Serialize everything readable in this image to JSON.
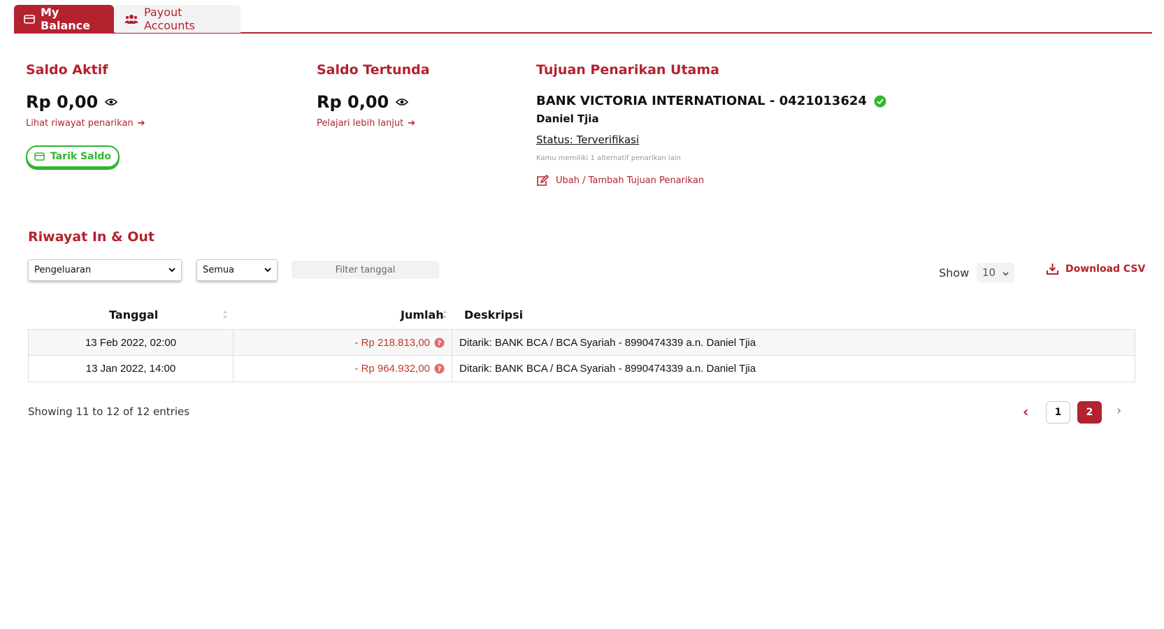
{
  "tabs": [
    {
      "label": "My Balance",
      "active": true
    },
    {
      "label": "Payout Accounts",
      "active": false
    }
  ],
  "colors": {
    "brand": "#b4222e",
    "success": "#2eb82e",
    "negative": "#c0392b"
  },
  "saldo_aktif": {
    "title": "Saldo Aktif",
    "amount": "Rp 0,00",
    "link": "Lihat riwayat penarikan",
    "button": "Tarik Saldo"
  },
  "saldo_tertunda": {
    "title": "Saldo Tertunda",
    "amount": "Rp 0,00",
    "link": "Pelajari lebih lanjut"
  },
  "tujuan": {
    "title": "Tujuan Penarikan Utama",
    "bank": "BANK VICTORIA INTERNATIONAL - 0421013624",
    "holder": "Daniel Tjia",
    "status": "Status: Terverifikasi",
    "alt_note": "Kamu memiliki 1 alternatif penarikan lain",
    "edit_link": "Ubah / Tambah Tujuan Penarikan"
  },
  "history": {
    "title": "Riwayat In & Out",
    "filter_type": "Pengeluaran",
    "filter_status": "Semua",
    "filter_date_placeholder": "Filter tanggal",
    "show_label": "Show",
    "show_value": "10",
    "download": "Download CSV",
    "columns": [
      "Tanggal",
      "Jumlah",
      "Deskripsi"
    ],
    "rows": [
      {
        "date": "13 Feb 2022, 02:00",
        "amount": "- Rp 218.813,00",
        "desc": "Ditarik: BANK BCA / BCA Syariah - 8990474339 a.n. Daniel Tjia"
      },
      {
        "date": "13 Jan 2022, 14:00",
        "amount": "- Rp 964.932,00",
        "desc": "Ditarik: BANK BCA / BCA Syariah - 8990474339 a.n. Daniel Tjia"
      }
    ],
    "showing": "Showing 11 to 12 of 12 entries",
    "pagination": {
      "prev": "‹",
      "pages": [
        "1",
        "2"
      ],
      "current": "2",
      "next": "›"
    }
  },
  "icons": [
    "card-icon",
    "users-icon",
    "eye-icon",
    "arrow-right-icon",
    "check-circle-icon",
    "edit-icon",
    "chevron-down-icon",
    "download-icon",
    "sort-icon",
    "question-icon"
  ]
}
